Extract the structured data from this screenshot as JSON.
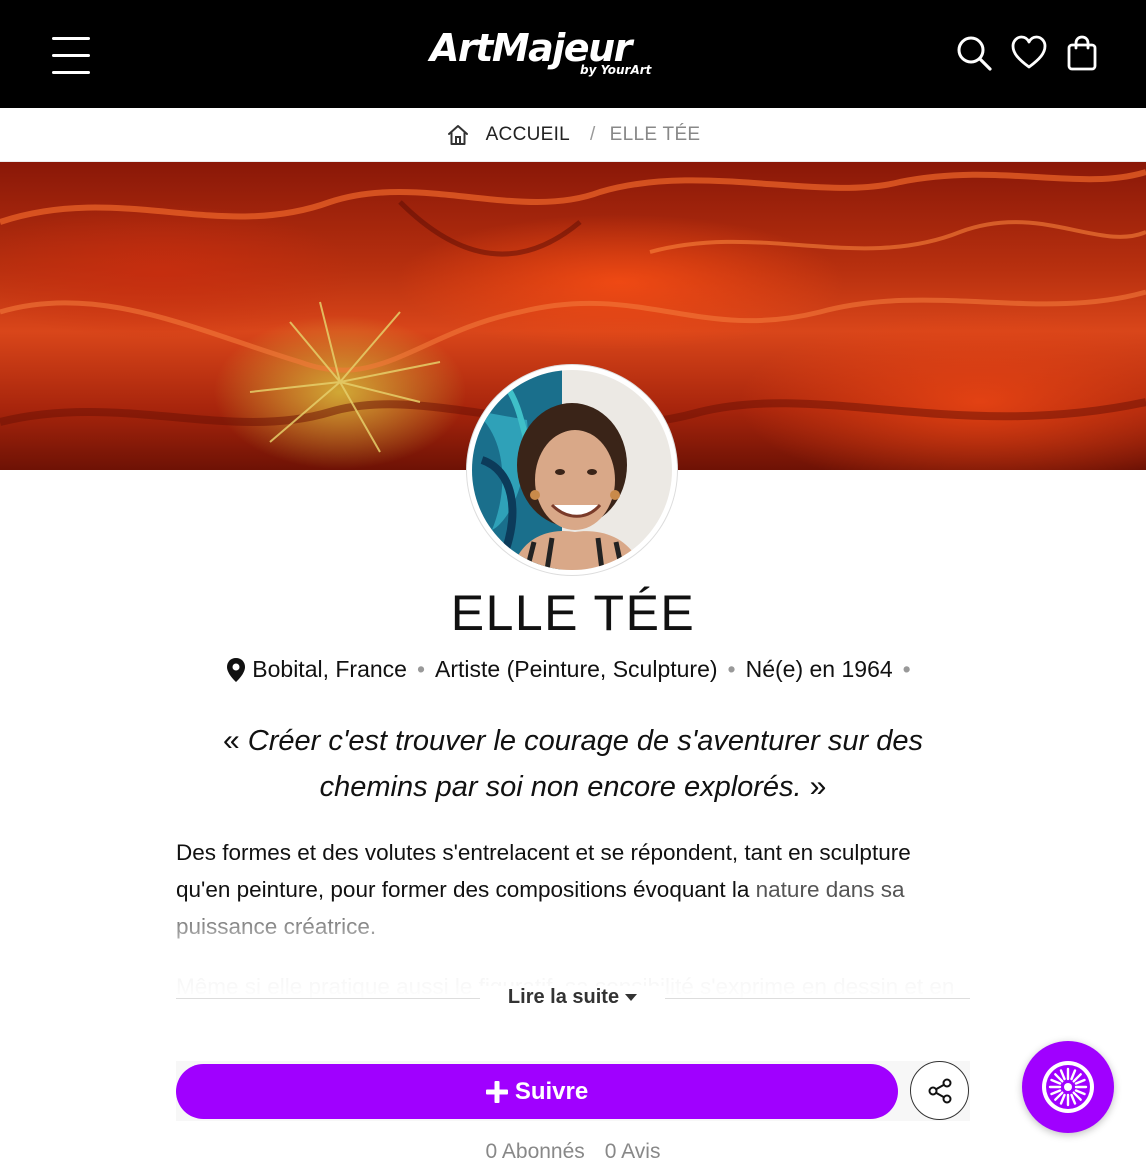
{
  "header": {
    "logo_text": "ArtMajeur",
    "logo_sub": "by YourArt",
    "icons": [
      "menu-icon",
      "search-icon",
      "heart-icon",
      "shopping-bag-icon"
    ]
  },
  "breadcrumb": {
    "home": "ACCUEIL",
    "separator": "/",
    "current": "ELLE TÉE"
  },
  "profile": {
    "name": "ELLE TÉE",
    "location": "Bobital, France",
    "role": "Artiste (Peinture, Sculpture)",
    "born": "Né(e) en 1964",
    "dot": "•",
    "quote_open": "«",
    "quote": "Créer c'est trouver le courage de s'aventurer sur des chemins par soi non encore explorés.",
    "quote_close": "»",
    "bio_line1": "Des formes et des volutes s'entrelacent et se répondent, tant en sculpture qu'en peinture, pour former des compositions évoquant la",
    "bio_line2": "nature dans sa puissance créatrice.",
    "bio_faded": "Même si elle pratique aussi le figuratif, sa sensibilité s'exprime en dessin et en",
    "read_more": "Lire la suite"
  },
  "actions": {
    "follow_label": "Suivre",
    "followers": "0 Abonnés",
    "reviews": "0 Avis"
  },
  "colors": {
    "accent": "#a000ff",
    "header_bg": "#000000"
  }
}
